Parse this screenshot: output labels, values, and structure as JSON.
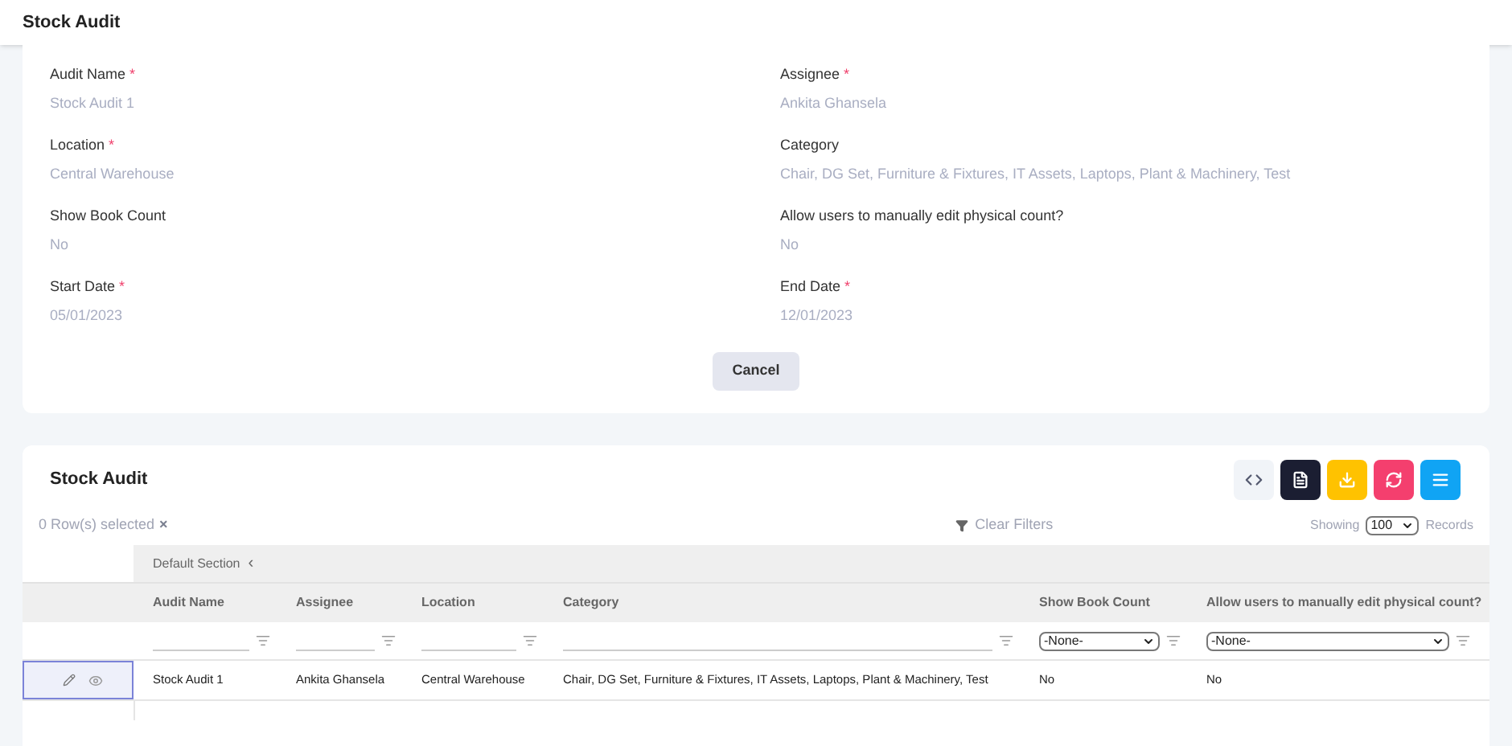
{
  "page_title": "Stock Audit",
  "form": {
    "fields": [
      {
        "label": "Audit Name",
        "required": true,
        "value": "Stock Audit 1"
      },
      {
        "label": "Assignee",
        "required": true,
        "value": "Ankita Ghansela"
      },
      {
        "label": "Location",
        "required": true,
        "value": "Central Warehouse"
      },
      {
        "label": "Category",
        "required": false,
        "value": "Chair, DG Set, Furniture & Fixtures, IT Assets, Laptops, Plant & Machinery, Test"
      },
      {
        "label": "Show Book Count",
        "required": false,
        "value": "No"
      },
      {
        "label": "Allow users to manually edit physical count?",
        "required": false,
        "value": "No"
      },
      {
        "label": "Start Date",
        "required": true,
        "value": "05/01/2023"
      },
      {
        "label": "End Date",
        "required": true,
        "value": "12/01/2023"
      }
    ],
    "required_mark": "*",
    "cancel": "Cancel"
  },
  "grid": {
    "title": "Stock Audit",
    "toolbar": [
      {
        "kind": "code"
      },
      {
        "kind": "document"
      },
      {
        "kind": "download"
      },
      {
        "kind": "refresh"
      },
      {
        "kind": "columns"
      }
    ],
    "selected_count": "0 Row(s) selected",
    "clear_selection": "×",
    "clear_filters": "Clear Filters",
    "showing": "Showing",
    "page_size": "100",
    "records": "Records",
    "section": "Default Section",
    "section_toggle": "‹",
    "columns": [
      {
        "label": "Audit Name",
        "kind": "text"
      },
      {
        "label": "Assignee",
        "kind": "text"
      },
      {
        "label": "Location",
        "kind": "text"
      },
      {
        "label": "Category",
        "kind": "text"
      },
      {
        "label": "Show Book Count",
        "kind": "select",
        "value": "-None-"
      },
      {
        "label": "Allow users to manually edit physical count?",
        "kind": "select",
        "value": "-None-"
      }
    ],
    "rows": [
      {
        "selected": true,
        "cells": [
          "Stock Audit 1",
          "Ankita Ghansela",
          "Central Warehouse",
          "Chair, DG Set, Furniture & Fixtures, IT Assets, Laptops, Plant & Machinery, Test",
          "No",
          "No"
        ]
      }
    ]
  }
}
